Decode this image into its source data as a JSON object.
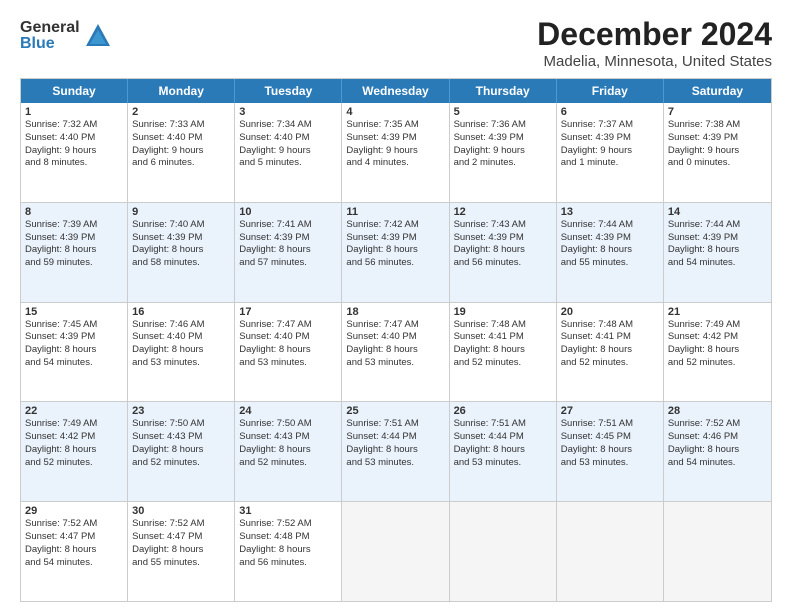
{
  "logo": {
    "general": "General",
    "blue": "Blue"
  },
  "title": "December 2024",
  "subtitle": "Madelia, Minnesota, United States",
  "header_days": [
    "Sunday",
    "Monday",
    "Tuesday",
    "Wednesday",
    "Thursday",
    "Friday",
    "Saturday"
  ],
  "rows": [
    [
      {
        "day": "1",
        "lines": [
          "Sunrise: 7:32 AM",
          "Sunset: 4:40 PM",
          "Daylight: 9 hours",
          "and 8 minutes."
        ]
      },
      {
        "day": "2",
        "lines": [
          "Sunrise: 7:33 AM",
          "Sunset: 4:40 PM",
          "Daylight: 9 hours",
          "and 6 minutes."
        ]
      },
      {
        "day": "3",
        "lines": [
          "Sunrise: 7:34 AM",
          "Sunset: 4:40 PM",
          "Daylight: 9 hours",
          "and 5 minutes."
        ]
      },
      {
        "day": "4",
        "lines": [
          "Sunrise: 7:35 AM",
          "Sunset: 4:39 PM",
          "Daylight: 9 hours",
          "and 4 minutes."
        ]
      },
      {
        "day": "5",
        "lines": [
          "Sunrise: 7:36 AM",
          "Sunset: 4:39 PM",
          "Daylight: 9 hours",
          "and 2 minutes."
        ]
      },
      {
        "day": "6",
        "lines": [
          "Sunrise: 7:37 AM",
          "Sunset: 4:39 PM",
          "Daylight: 9 hours",
          "and 1 minute."
        ]
      },
      {
        "day": "7",
        "lines": [
          "Sunrise: 7:38 AM",
          "Sunset: 4:39 PM",
          "Daylight: 9 hours",
          "and 0 minutes."
        ]
      }
    ],
    [
      {
        "day": "8",
        "lines": [
          "Sunrise: 7:39 AM",
          "Sunset: 4:39 PM",
          "Daylight: 8 hours",
          "and 59 minutes."
        ]
      },
      {
        "day": "9",
        "lines": [
          "Sunrise: 7:40 AM",
          "Sunset: 4:39 PM",
          "Daylight: 8 hours",
          "and 58 minutes."
        ]
      },
      {
        "day": "10",
        "lines": [
          "Sunrise: 7:41 AM",
          "Sunset: 4:39 PM",
          "Daylight: 8 hours",
          "and 57 minutes."
        ]
      },
      {
        "day": "11",
        "lines": [
          "Sunrise: 7:42 AM",
          "Sunset: 4:39 PM",
          "Daylight: 8 hours",
          "and 56 minutes."
        ]
      },
      {
        "day": "12",
        "lines": [
          "Sunrise: 7:43 AM",
          "Sunset: 4:39 PM",
          "Daylight: 8 hours",
          "and 56 minutes."
        ]
      },
      {
        "day": "13",
        "lines": [
          "Sunrise: 7:44 AM",
          "Sunset: 4:39 PM",
          "Daylight: 8 hours",
          "and 55 minutes."
        ]
      },
      {
        "day": "14",
        "lines": [
          "Sunrise: 7:44 AM",
          "Sunset: 4:39 PM",
          "Daylight: 8 hours",
          "and 54 minutes."
        ]
      }
    ],
    [
      {
        "day": "15",
        "lines": [
          "Sunrise: 7:45 AM",
          "Sunset: 4:39 PM",
          "Daylight: 8 hours",
          "and 54 minutes."
        ]
      },
      {
        "day": "16",
        "lines": [
          "Sunrise: 7:46 AM",
          "Sunset: 4:40 PM",
          "Daylight: 8 hours",
          "and 53 minutes."
        ]
      },
      {
        "day": "17",
        "lines": [
          "Sunrise: 7:47 AM",
          "Sunset: 4:40 PM",
          "Daylight: 8 hours",
          "and 53 minutes."
        ]
      },
      {
        "day": "18",
        "lines": [
          "Sunrise: 7:47 AM",
          "Sunset: 4:40 PM",
          "Daylight: 8 hours",
          "and 53 minutes."
        ]
      },
      {
        "day": "19",
        "lines": [
          "Sunrise: 7:48 AM",
          "Sunset: 4:41 PM",
          "Daylight: 8 hours",
          "and 52 minutes."
        ]
      },
      {
        "day": "20",
        "lines": [
          "Sunrise: 7:48 AM",
          "Sunset: 4:41 PM",
          "Daylight: 8 hours",
          "and 52 minutes."
        ]
      },
      {
        "day": "21",
        "lines": [
          "Sunrise: 7:49 AM",
          "Sunset: 4:42 PM",
          "Daylight: 8 hours",
          "and 52 minutes."
        ]
      }
    ],
    [
      {
        "day": "22",
        "lines": [
          "Sunrise: 7:49 AM",
          "Sunset: 4:42 PM",
          "Daylight: 8 hours",
          "and 52 minutes."
        ]
      },
      {
        "day": "23",
        "lines": [
          "Sunrise: 7:50 AM",
          "Sunset: 4:43 PM",
          "Daylight: 8 hours",
          "and 52 minutes."
        ]
      },
      {
        "day": "24",
        "lines": [
          "Sunrise: 7:50 AM",
          "Sunset: 4:43 PM",
          "Daylight: 8 hours",
          "and 52 minutes."
        ]
      },
      {
        "day": "25",
        "lines": [
          "Sunrise: 7:51 AM",
          "Sunset: 4:44 PM",
          "Daylight: 8 hours",
          "and 53 minutes."
        ]
      },
      {
        "day": "26",
        "lines": [
          "Sunrise: 7:51 AM",
          "Sunset: 4:44 PM",
          "Daylight: 8 hours",
          "and 53 minutes."
        ]
      },
      {
        "day": "27",
        "lines": [
          "Sunrise: 7:51 AM",
          "Sunset: 4:45 PM",
          "Daylight: 8 hours",
          "and 53 minutes."
        ]
      },
      {
        "day": "28",
        "lines": [
          "Sunrise: 7:52 AM",
          "Sunset: 4:46 PM",
          "Daylight: 8 hours",
          "and 54 minutes."
        ]
      }
    ],
    [
      {
        "day": "29",
        "lines": [
          "Sunrise: 7:52 AM",
          "Sunset: 4:47 PM",
          "Daylight: 8 hours",
          "and 54 minutes."
        ]
      },
      {
        "day": "30",
        "lines": [
          "Sunrise: 7:52 AM",
          "Sunset: 4:47 PM",
          "Daylight: 8 hours",
          "and 55 minutes."
        ]
      },
      {
        "day": "31",
        "lines": [
          "Sunrise: 7:52 AM",
          "Sunset: 4:48 PM",
          "Daylight: 8 hours",
          "and 56 minutes."
        ]
      },
      {
        "day": "",
        "lines": []
      },
      {
        "day": "",
        "lines": []
      },
      {
        "day": "",
        "lines": []
      },
      {
        "day": "",
        "lines": []
      }
    ]
  ]
}
